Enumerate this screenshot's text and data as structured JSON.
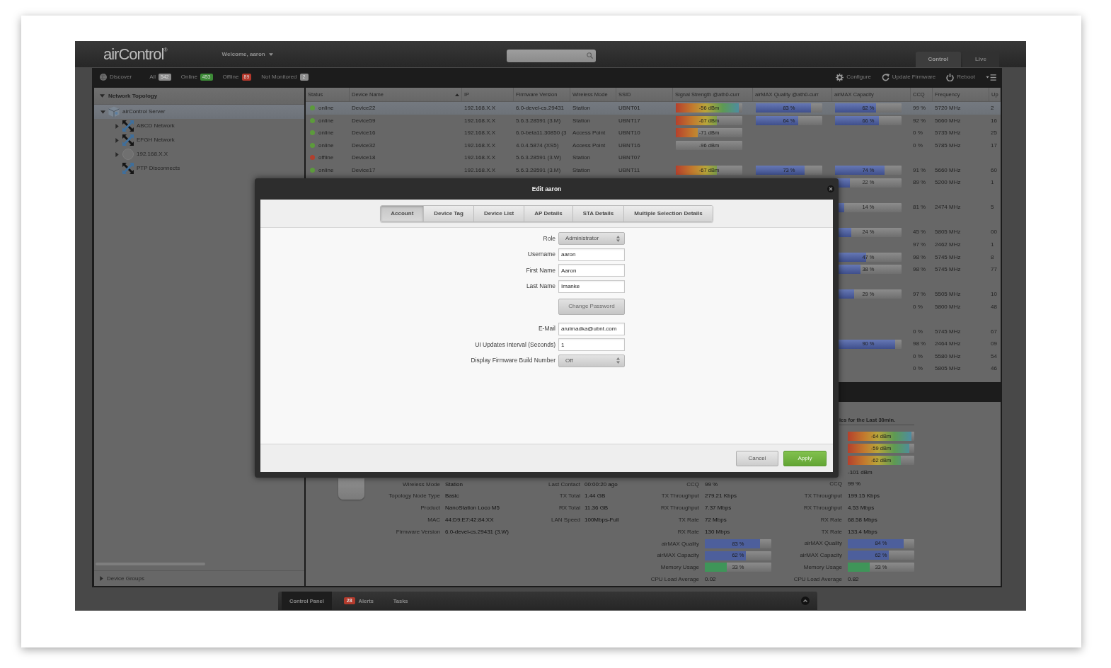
{
  "header": {
    "logo": "airControl$^{®}$",
    "welcome": "Welcome, aaron",
    "view_tabs": [
      {
        "label": "Control",
        "selected": true
      },
      {
        "label": "Live",
        "selected": false
      }
    ]
  },
  "toolbar": {
    "discover": "Discover",
    "filters": [
      {
        "label": "All",
        "count": "542",
        "color": "#8c8c8c"
      },
      {
        "label": "Online",
        "count": "453",
        "color": "#3d8b37"
      },
      {
        "label": "Offline",
        "count": "89",
        "color": "#b5382c"
      },
      {
        "label": "Not Monitored",
        "count": "2",
        "color": "#8c8c8c"
      }
    ],
    "actions": [
      {
        "kind": "configure",
        "label": "Configure"
      },
      {
        "kind": "update",
        "label": "Update Firmware"
      },
      {
        "kind": "reboot",
        "label": "Reboot"
      },
      {
        "kind": "menu"
      }
    ]
  },
  "sidebar": {
    "title": "Network Topology",
    "expanded": true,
    "tree": [
      {
        "label": "airControl Server",
        "kind": "server",
        "expanded": true,
        "selected": true,
        "children": [
          {
            "label": "ABCD Network",
            "kind": "network",
            "expanded": false,
            "selected": false
          },
          {
            "label": "EFGH Network",
            "kind": "network",
            "expanded": false,
            "selected": false
          },
          {
            "label": "192.168.X.X",
            "kind": "host",
            "expanded": false,
            "selected": false
          },
          {
            "label": "PTP Disconnects",
            "kind": "network",
            "selected": false
          }
        ]
      }
    ],
    "footer": {
      "label": "Device Groups",
      "expanded": false
    }
  },
  "table": {
    "columns": [
      {
        "label": "Status",
        "sorted": false
      },
      {
        "label": "Device Name",
        "sorted": true
      },
      {
        "label": "IP",
        "sorted": false
      },
      {
        "label": "Firmware Version",
        "sorted": false
      },
      {
        "label": "Wireless Mode",
        "sorted": false
      },
      {
        "label": "SSID",
        "sorted": false
      },
      {
        "label": "Signal Strength @ath0-curr",
        "sorted": false
      },
      {
        "label": "airMAX Quality @ath0-curr",
        "sorted": false
      },
      {
        "label": "airMAX Capacity",
        "sorted": false
      },
      {
        "label": "CCQ",
        "sorted": false
      },
      {
        "label": "Frequency",
        "sorted": false
      },
      {
        "label": "Up",
        "sorted": false
      }
    ],
    "rows": [
      {
        "selected": true,
        "status": {
          "label": "online",
          "color": "#5c9a3c"
        },
        "name": "Device22",
        "ip": "192.168.X.X",
        "firmware": "6.0-devel-cs.29431",
        "mode": "Station",
        "ssid": "UBNT01",
        "signal": {
          "reading": "-56 dBm",
          "level": 0.95
        },
        "quality": {
          "reading": "83 %",
          "level": 0.83
        },
        "capacity": {
          "reading": "62 %",
          "level": 0.62
        },
        "ccq": "99 %",
        "frequency": "5720 MHz",
        "up": "2"
      },
      {
        "selected": false,
        "status": {
          "label": "online",
          "color": "#5c9a3c"
        },
        "name": "Device59",
        "ip": "192.168.X.X",
        "firmware": "5.6.3.28591 (3.M)",
        "mode": "Station",
        "ssid": "UBNT17",
        "signal": {
          "reading": "-67 dBm",
          "level": 0.62
        },
        "quality": {
          "reading": "64 %",
          "level": 0.64
        },
        "capacity": {
          "reading": "66 %",
          "level": 0.66
        },
        "ccq": "92 %",
        "frequency": "5660 MHz",
        "up": "16"
      },
      {
        "selected": false,
        "status": {
          "label": "online",
          "color": "#5c9a3c"
        },
        "name": "Device16",
        "ip": "192.168.X.X",
        "firmware": "6.0-beta11.30850 (3",
        "mode": "Access Point",
        "ssid": "UBNT10",
        "signal": {
          "reading": "-71 dBm",
          "level": 0.33
        },
        "ccq": "0 %",
        "frequency": "5735 MHz",
        "up": "25"
      },
      {
        "selected": false,
        "status": {
          "label": "online",
          "color": "#5c9a3c"
        },
        "name": "Device32",
        "ip": "192.168.X.X",
        "firmware": "4.0.4.5874 (XS5)",
        "mode": "Access Point",
        "ssid": "UBNT16",
        "signal": {
          "reading": "-96 dBm",
          "level": 0
        },
        "ccq": "0 %",
        "frequency": "5785 MHz",
        "up": "17"
      },
      {
        "selected": false,
        "status": {
          "label": "offline",
          "color": "#b0402e"
        },
        "name": "Device18",
        "ip": "192.168.X.X",
        "firmware": "5.6.3.28591 (3.W)",
        "mode": "Station",
        "ssid": "UBNT07"
      },
      {
        "selected": false,
        "status": {
          "label": "online",
          "color": "#5c9a3c"
        },
        "name": "Device17",
        "ip": "192.168.X.X",
        "firmware": "5.6.3.28591 (3.M)",
        "mode": "Station",
        "ssid": "UBNT11",
        "signal": {
          "reading": "-67 dBm",
          "level": 0.62
        },
        "quality": {
          "reading": "73 %",
          "level": 0.73
        },
        "capacity": {
          "reading": "74 %",
          "level": 0.74
        },
        "ccq": "91 %",
        "frequency": "5660 MHz",
        "up": "60"
      },
      {
        "selected": false,
        "capacity": {
          "reading": "22 %",
          "level": 0.22
        },
        "ccq": "89 %",
        "frequency": "5200 MHz",
        "up": "1"
      },
      {
        "selected": false
      },
      {
        "selected": false,
        "capacity": {
          "reading": "14 %",
          "level": 0.14
        },
        "ccq": "81 %",
        "frequency": "2474 MHz",
        "up": "5"
      },
      {
        "selected": false
      },
      {
        "selected": false,
        "capacity": {
          "reading": "24 %",
          "level": 0.24
        },
        "ccq": "45 %",
        "frequency": "5805 MHz",
        "up": "00"
      },
      {
        "selected": false,
        "ccq": "97 %",
        "frequency": "2462 MHz",
        "up": "1"
      },
      {
        "selected": false,
        "capacity": {
          "reading": "47 %",
          "level": 0.47
        },
        "ccq": "98 %",
        "frequency": "5745 MHz",
        "up": "8"
      },
      {
        "selected": false,
        "capacity": {
          "reading": "38 %",
          "level": 0.38
        },
        "ccq": "98 %",
        "frequency": "5745 MHz",
        "up": "77"
      },
      {
        "selected": false
      },
      {
        "selected": false,
        "capacity": {
          "reading": "29 %",
          "level": 0.29
        },
        "ccq": "97 %",
        "frequency": "5505 MHz",
        "up": "10"
      },
      {
        "selected": false,
        "ccq": "0 %",
        "frequency": "5800 MHz",
        "up": "48"
      },
      {
        "selected": false
      },
      {
        "selected": false,
        "ccq": "0 %",
        "frequency": "5745 MHz",
        "up": "67"
      },
      {
        "selected": false,
        "capacity": {
          "reading": "90 %",
          "level": 0.9
        },
        "ccq": "98 %",
        "frequency": "2464 MHz",
        "up": "09"
      },
      {
        "selected": false,
        "ccq": "0 %",
        "frequency": "5580 MHz",
        "up": "54"
      },
      {
        "selected": false,
        "ccq": "0 %",
        "frequency": "5805 MHz",
        "up": "46"
      }
    ]
  },
  "details": {
    "stats_title": "ics for the Last 30min.",
    "groups": [
      [
        {
          "kind": "text",
          "label": "Wireless Mode",
          "value": "Station"
        },
        {
          "kind": "text",
          "label": "Topology Node Type",
          "value": "Basic"
        },
        {
          "kind": "text",
          "label": "Product",
          "value": "NanoStation Loco M5"
        },
        {
          "kind": "text",
          "label": "MAC",
          "value": "44:D9:E7:42:84:XX"
        },
        {
          "kind": "text",
          "label": "Firmware Version",
          "value": "6.0-devel-cs.29431 (3.W)"
        }
      ],
      [
        {
          "kind": "text",
          "label": "Last Contact",
          "value": "00:00:20 ago"
        },
        {
          "kind": "text",
          "label": "TX Total",
          "value": "1.44 GB"
        },
        {
          "kind": "text",
          "label": "RX Total",
          "value": "11.36 GB"
        },
        {
          "kind": "text",
          "label": "LAN Speed",
          "value": "100Mbps-Full"
        }
      ],
      [
        {
          "kind": "text",
          "label": "CCQ",
          "value": "99 %"
        },
        {
          "kind": "text",
          "label": "TX Throughput",
          "value": "279.21 Kbps"
        },
        {
          "kind": "text",
          "label": "RX Throughput",
          "value": "7.37 Mbps"
        },
        {
          "kind": "text",
          "label": "TX Rate",
          "value": "72 Mbps"
        },
        {
          "kind": "text",
          "label": "RX Rate",
          "value": "130 Mbps"
        },
        {
          "kind": "meter",
          "label": "airMAX Quality",
          "reading": "83 %",
          "level": 0.83,
          "color": "#4d5f9c"
        },
        {
          "kind": "meter",
          "label": "airMAX Capacity",
          "reading": "62 %",
          "level": 0.62,
          "color": "#4d5f9c"
        },
        {
          "kind": "meter",
          "label": "Memory Usage",
          "reading": "33 %",
          "level": 0.33,
          "color": "#3f9559"
        },
        {
          "kind": "text",
          "label": "CPU Load Average",
          "value": "0.02"
        }
      ],
      [
        {
          "kind": "signal",
          "reading": "-64 dBm",
          "level": 0.96
        },
        {
          "kind": "signal",
          "reading": "-59 dBm",
          "level": 0.93
        },
        {
          "kind": "signal",
          "reading": "-62 dBm",
          "level": 0.8
        },
        {
          "kind": "text",
          "value": "-101 dBm"
        },
        {
          "kind": "text",
          "label": "CCQ",
          "value": "99 %"
        },
        {
          "kind": "text",
          "label": "TX Throughput",
          "value": "199.15 Kbps"
        },
        {
          "kind": "text",
          "label": "RX Throughput",
          "value": "4.53 Mbps"
        },
        {
          "kind": "text",
          "label": "RX Rate",
          "value": "68.58 Mbps"
        },
        {
          "kind": "text",
          "label": "TX Rate",
          "value": "133.4 Mbps"
        },
        {
          "kind": "meter",
          "label": "airMAX Quality",
          "reading": "84 %",
          "level": 0.84,
          "color": "#4d5f9c"
        },
        {
          "kind": "meter",
          "label": "airMAX Capacity",
          "reading": "62 %",
          "level": 0.62,
          "color": "#4d5f9c"
        },
        {
          "kind": "meter",
          "label": "Memory Usage",
          "reading": "33 %",
          "level": 0.33,
          "color": "#3f9559"
        },
        {
          "kind": "text",
          "label": "CPU Load Average",
          "value": "0.82"
        }
      ]
    ]
  },
  "dock": {
    "tabs": [
      {
        "label": "Control Panel",
        "selected": true
      },
      {
        "label": "Alerts",
        "badge": "28",
        "selected": false
      },
      {
        "label": "Tasks",
        "selected": false
      }
    ]
  },
  "dialog": {
    "title": "Edit aaron",
    "tabs": [
      {
        "label": "Account",
        "selected": true
      },
      {
        "label": "Device Tag",
        "selected": false
      },
      {
        "label": "Device List",
        "selected": false
      },
      {
        "label": "AP Details",
        "selected": false
      },
      {
        "label": "STA Details",
        "selected": false
      },
      {
        "label": "Multiple Selection Details",
        "selected": false
      }
    ],
    "fields": [
      {
        "kind": "select",
        "label": "Role",
        "value": "Administrator"
      },
      {
        "kind": "input",
        "label": "Username",
        "value": "aaron"
      },
      {
        "kind": "input",
        "label": "First Name",
        "value": "Aaron"
      },
      {
        "kind": "input",
        "label": "Last Name",
        "value": "Imanke"
      },
      {
        "kind": "button",
        "label": "Change Password"
      },
      {
        "kind": "input",
        "label": "E-Mail",
        "value": "arulmadka@ubnt.com"
      },
      {
        "kind": "input",
        "label": "UI Updates Interval (Seconds)",
        "value": "1"
      },
      {
        "kind": "select",
        "label": "Display Firmware Build Number",
        "value": "Off"
      }
    ],
    "buttons": [
      {
        "kind": "cancel",
        "label": "Cancel"
      },
      {
        "kind": "apply",
        "label": "Apply"
      }
    ]
  }
}
